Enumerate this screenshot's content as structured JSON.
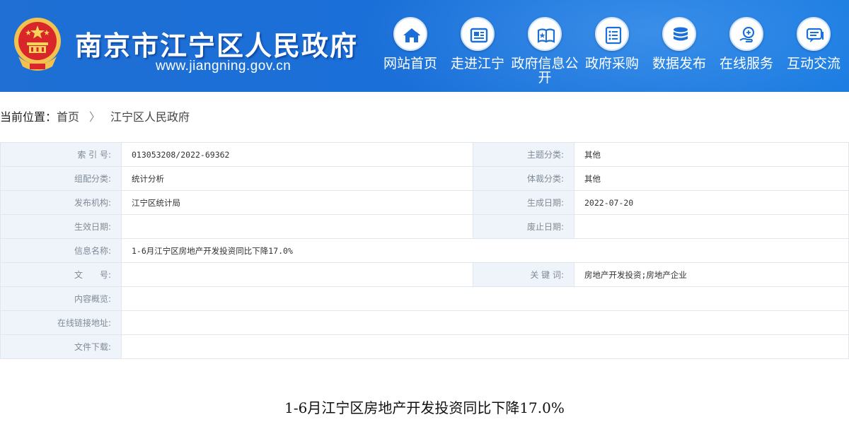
{
  "header": {
    "title": "南京市江宁区人民政府",
    "url": "www.jiangning.gov.cn",
    "nav": [
      {
        "label": "网站首页",
        "icon": "home-icon"
      },
      {
        "label": "走进江宁",
        "icon": "newspaper-icon"
      },
      {
        "label": "政府信息公开",
        "icon": "open-book-icon"
      },
      {
        "label": "政府采购",
        "icon": "list-icon"
      },
      {
        "label": "数据发布",
        "icon": "database-icon"
      },
      {
        "label": "在线服务",
        "icon": "service-hand-icon"
      },
      {
        "label": "互动交流",
        "icon": "chat-icon"
      }
    ]
  },
  "breadcrumb": {
    "label": "当前位置：",
    "items": [
      "首页",
      "江宁区人民政府"
    ],
    "separator": "〉"
  },
  "meta": {
    "index_label": "索 引 号:",
    "index_value": "013053208/2022-69362",
    "topic_label": "主题分类:",
    "topic_value": "其他",
    "group_label": "组配分类:",
    "group_value": "统计分析",
    "genre_label": "体裁分类:",
    "genre_value": "其他",
    "publisher_label": "发布机构:",
    "publisher_value": "江宁区统计局",
    "created_label": "生成日期:",
    "created_value": "2022-07-20",
    "effective_label": "生效日期:",
    "effective_value": "",
    "abolished_label": "废止日期:",
    "abolished_value": "",
    "name_label": "信息名称:",
    "name_value": "1-6月江宁区房地产开发投资同比下降17.0%",
    "docno_label": "文　　号:",
    "docno_value": "",
    "keywords_label": "关 键 词:",
    "keywords_value": "房地产开发投资;房地产企业",
    "summary_label": "内容概览:",
    "summary_value": "",
    "link_label": "在线链接地址:",
    "link_value": "",
    "download_label": "文件下载:",
    "download_value": ""
  },
  "article": {
    "title": "1-6月江宁区房地产开发投资同比下降17.0%"
  },
  "colors": {
    "header_blue": "#1a6fd8",
    "label_bg": "#eef4fa",
    "border": "#dfe6ee"
  }
}
